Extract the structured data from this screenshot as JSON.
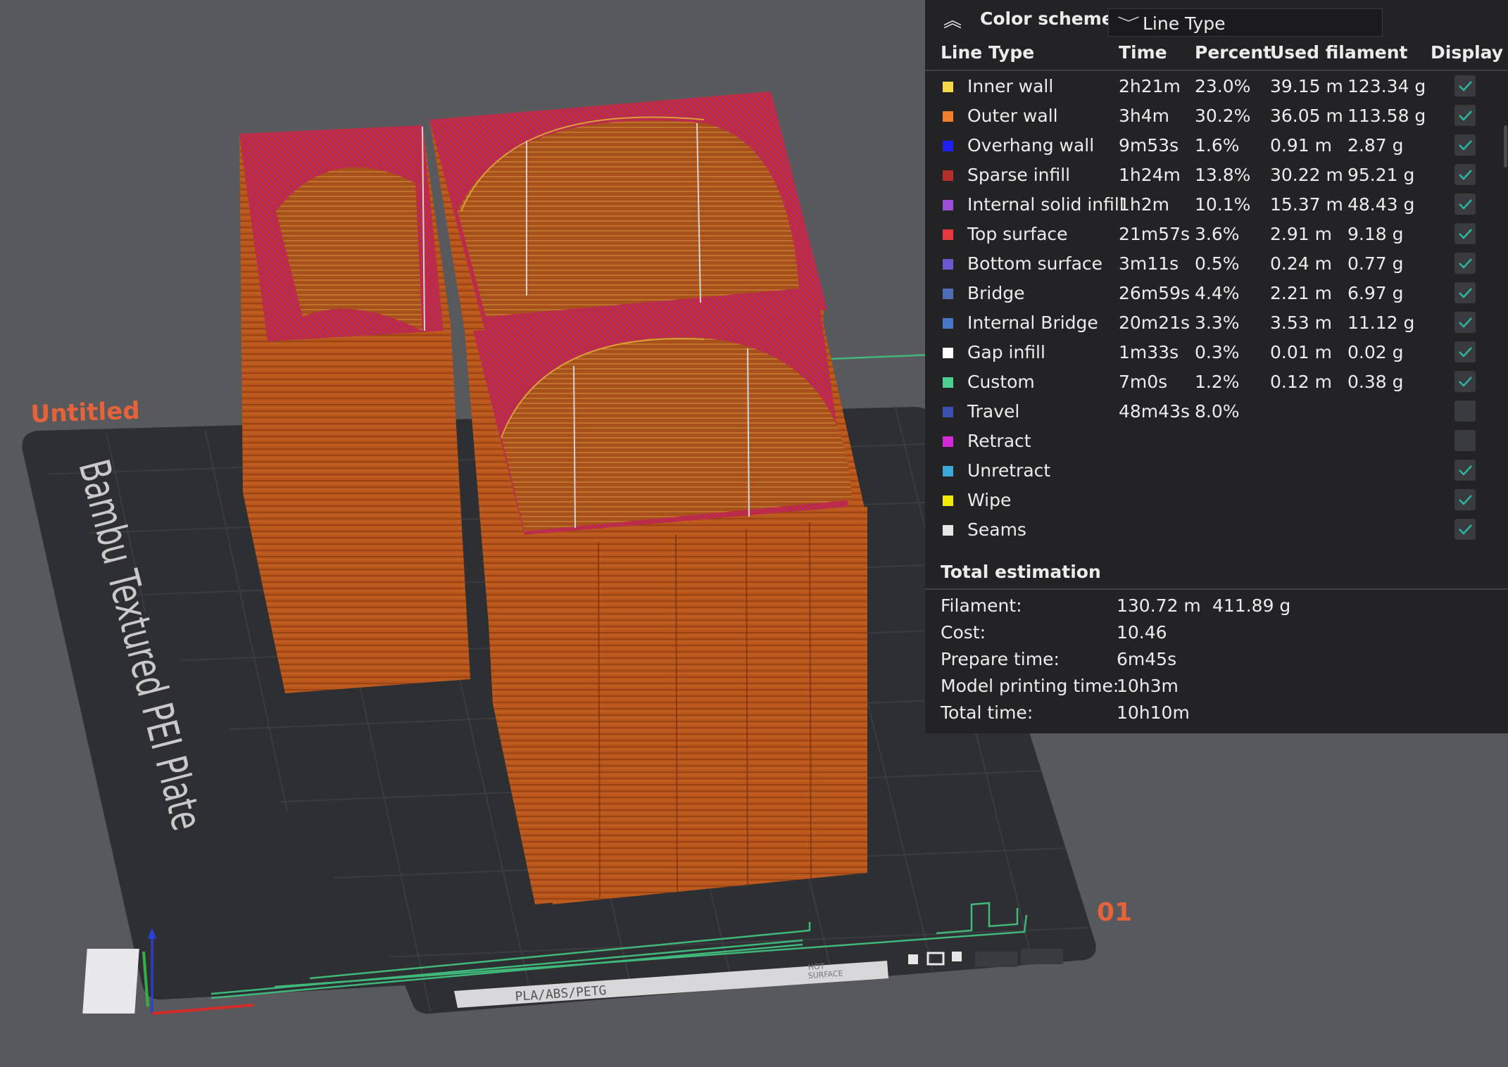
{
  "viewport": {
    "plate_name": "Untitled",
    "plate_number": "01",
    "bed_label": "Bambu Textured PEI Plate",
    "bed_strip_text": "PLA/ABS/PETG",
    "bed_warning_line1": "HOT",
    "bed_warning_line2": "SURFACE",
    "colors": {
      "background": "#58595d",
      "bed": "#2e2f33",
      "grid": "#3b3c40",
      "model": "#b8561c",
      "model_top": "#c8303a",
      "plate_label": "#e5633a",
      "travel": "#3fb87a"
    }
  },
  "legend": {
    "collapse_icon": "chevrons-up-icon",
    "color_scheme_label": "Color scheme",
    "color_scheme_value": "Line Type",
    "dropdown_icon": "chevron-down-icon",
    "columns": {
      "type": "Line Type",
      "time": "Time",
      "percent": "Percent",
      "used": "Used filament",
      "display": "Display"
    },
    "rows": [
      {
        "name": "Inner wall",
        "color": "#f5d94a",
        "time": "2h21m",
        "percent": "23.0%",
        "length": "39.15 m",
        "weight": "123.34 g",
        "display": true
      },
      {
        "name": "Outer wall",
        "color": "#f07e2f",
        "time": "3h4m",
        "percent": "30.2%",
        "length": "36.05 m",
        "weight": "113.58 g",
        "display": true
      },
      {
        "name": "Overhang wall",
        "color": "#2020f0",
        "time": "9m53s",
        "percent": "1.6%",
        "length": "0.91 m",
        "weight": "2.87 g",
        "display": true
      },
      {
        "name": "Sparse infill",
        "color": "#b3302a",
        "time": "1h24m",
        "percent": "13.8%",
        "length": "30.22 m",
        "weight": "95.21 g",
        "display": true
      },
      {
        "name": "Internal solid infill",
        "color": "#9a4fd6",
        "time": "1h2m",
        "percent": "10.1%",
        "length": "15.37 m",
        "weight": "48.43 g",
        "display": true
      },
      {
        "name": "Top surface",
        "color": "#e8393f",
        "time": "21m57s",
        "percent": "3.6%",
        "length": "2.91 m",
        "weight": "9.18 g",
        "display": true
      },
      {
        "name": "Bottom surface",
        "color": "#6a5acd",
        "time": "3m11s",
        "percent": "0.5%",
        "length": "0.24 m",
        "weight": "0.77 g",
        "display": true
      },
      {
        "name": "Bridge",
        "color": "#4f6eb5",
        "time": "26m59s",
        "percent": "4.4%",
        "length": "2.21 m",
        "weight": "6.97 g",
        "display": true
      },
      {
        "name": "Internal Bridge",
        "color": "#4a78c8",
        "time": "20m21s",
        "percent": "3.3%",
        "length": "3.53 m",
        "weight": "11.12 g",
        "display": true
      },
      {
        "name": "Gap infill",
        "color": "#ffffff",
        "time": "1m33s",
        "percent": "0.3%",
        "length": "0.01 m",
        "weight": "0.02 g",
        "display": true
      },
      {
        "name": "Custom",
        "color": "#4fcf8f",
        "time": "7m0s",
        "percent": "1.2%",
        "length": "0.12 m",
        "weight": "0.38 g",
        "display": true
      },
      {
        "name": "Travel",
        "color": "#3a4fb0",
        "time": "48m43s",
        "percent": "8.0%",
        "length": "",
        "weight": "",
        "display": false
      },
      {
        "name": "Retract",
        "color": "#d22bd6",
        "time": "",
        "percent": "",
        "length": "",
        "weight": "",
        "display": false
      },
      {
        "name": "Unretract",
        "color": "#3aa9d6",
        "time": "",
        "percent": "",
        "length": "",
        "weight": "",
        "display": true
      },
      {
        "name": "Wipe",
        "color": "#f2ea0a",
        "time": "",
        "percent": "",
        "length": "",
        "weight": "",
        "display": true
      },
      {
        "name": "Seams",
        "color": "#e6e6e6",
        "time": "",
        "percent": "",
        "length": "",
        "weight": "",
        "display": true
      }
    ],
    "total": {
      "title": "Total estimation",
      "rows": [
        {
          "label": "Filament:",
          "v1": "130.72 m",
          "v2": "411.89 g"
        },
        {
          "label": "Cost:",
          "v1": "10.46",
          "v2": ""
        },
        {
          "label": "Prepare time:",
          "v1": "6m45s",
          "v2": ""
        },
        {
          "label": "Model printing time:",
          "v1": "10h3m",
          "v2": ""
        },
        {
          "label": "Total time:",
          "v1": "10h10m",
          "v2": ""
        }
      ]
    },
    "check_color": "#2bb5a0"
  }
}
